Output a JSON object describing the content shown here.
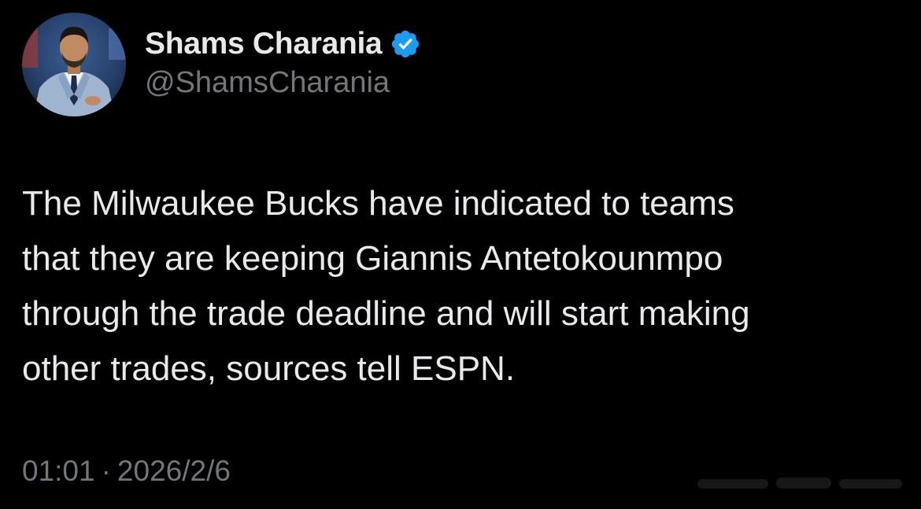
{
  "author": {
    "display_name": "Shams Charania",
    "handle": "@ShamsCharania",
    "verified": true,
    "avatar_icon": "profile-photo",
    "badge_color": "#1d9bf0"
  },
  "tweet": {
    "text": "The Milwaukee Bucks have indicated to teams\nthat they are keeping Giannis Antetokounmpo\nthrough the trade deadline and will start making\nother trades, sources tell ESPN.",
    "time": "01:01",
    "separator": "·",
    "date": "2026/2/6"
  },
  "theme": {
    "background": "#000000",
    "primary_text": "#e7e9ea",
    "secondary_text": "#71767b"
  }
}
